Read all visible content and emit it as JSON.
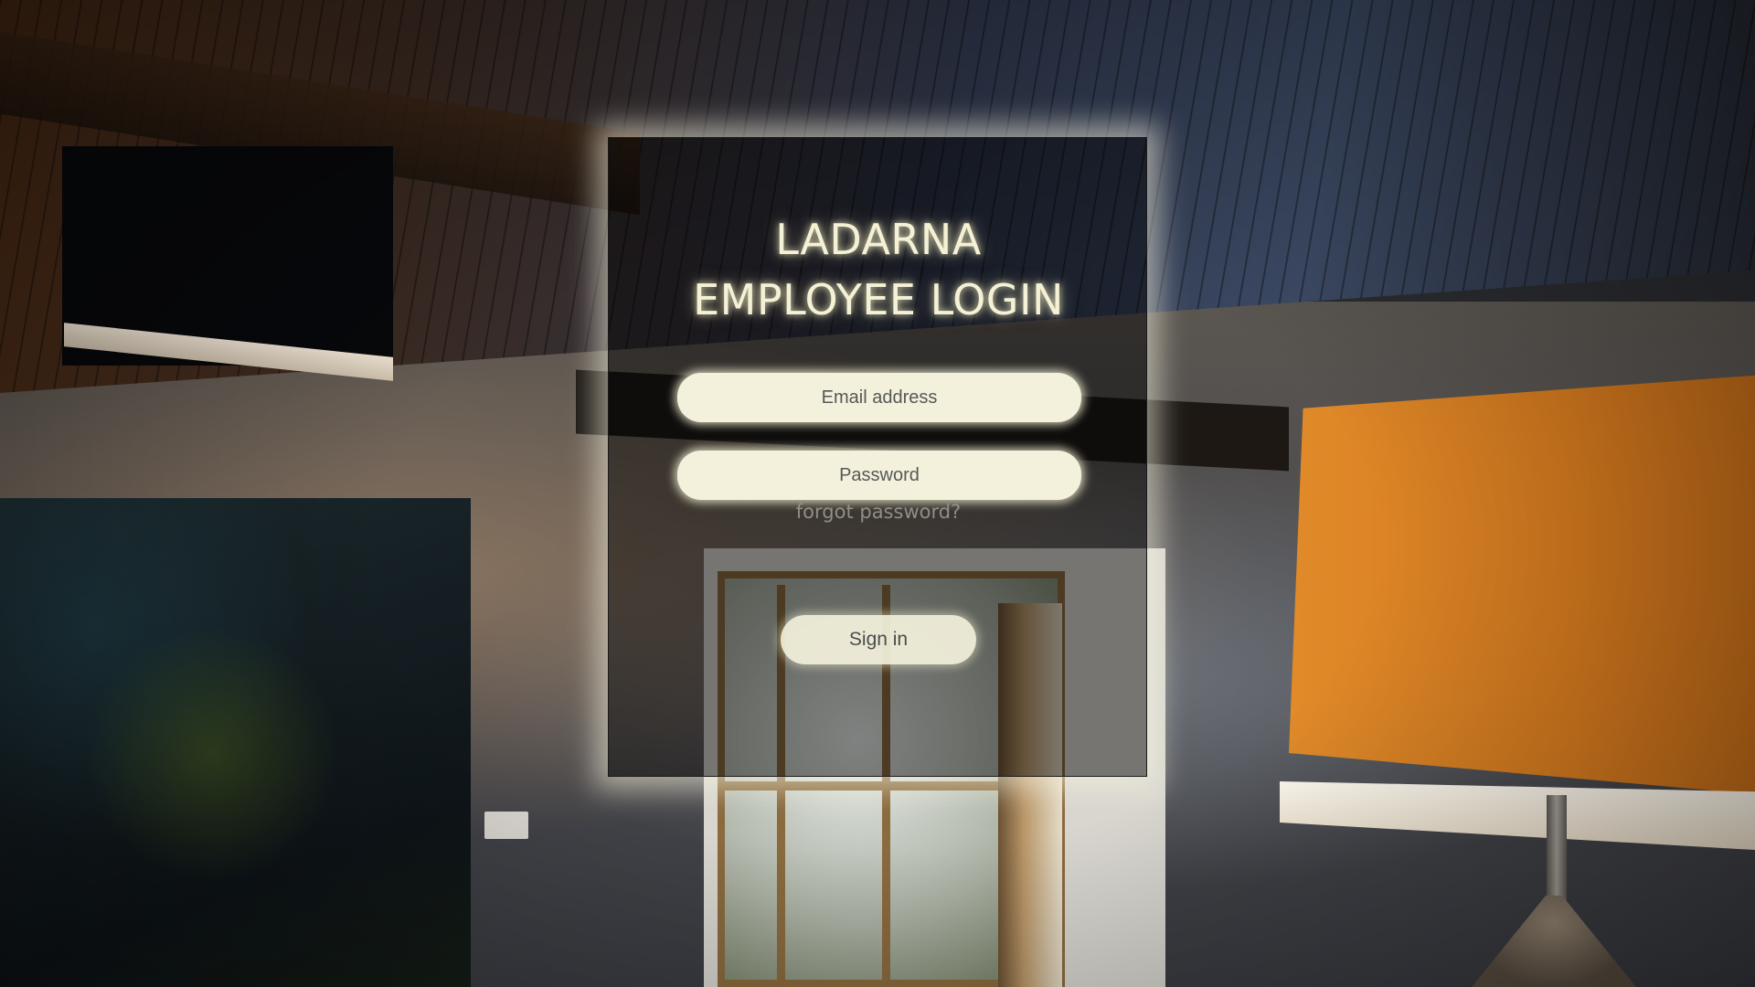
{
  "login": {
    "title_line1": "LADARNA",
    "title_line2": "EMPLOYEE LOGIN",
    "email_placeholder": "Email address",
    "password_placeholder": "Password",
    "forgot_label": "forgot password?",
    "signin_label": "Sign in"
  },
  "colors": {
    "card_glow": "#f5f3de",
    "input_background": "#f3f1dc",
    "title_text": "#f4f1d6",
    "forgot_text": "#8f8f86"
  }
}
